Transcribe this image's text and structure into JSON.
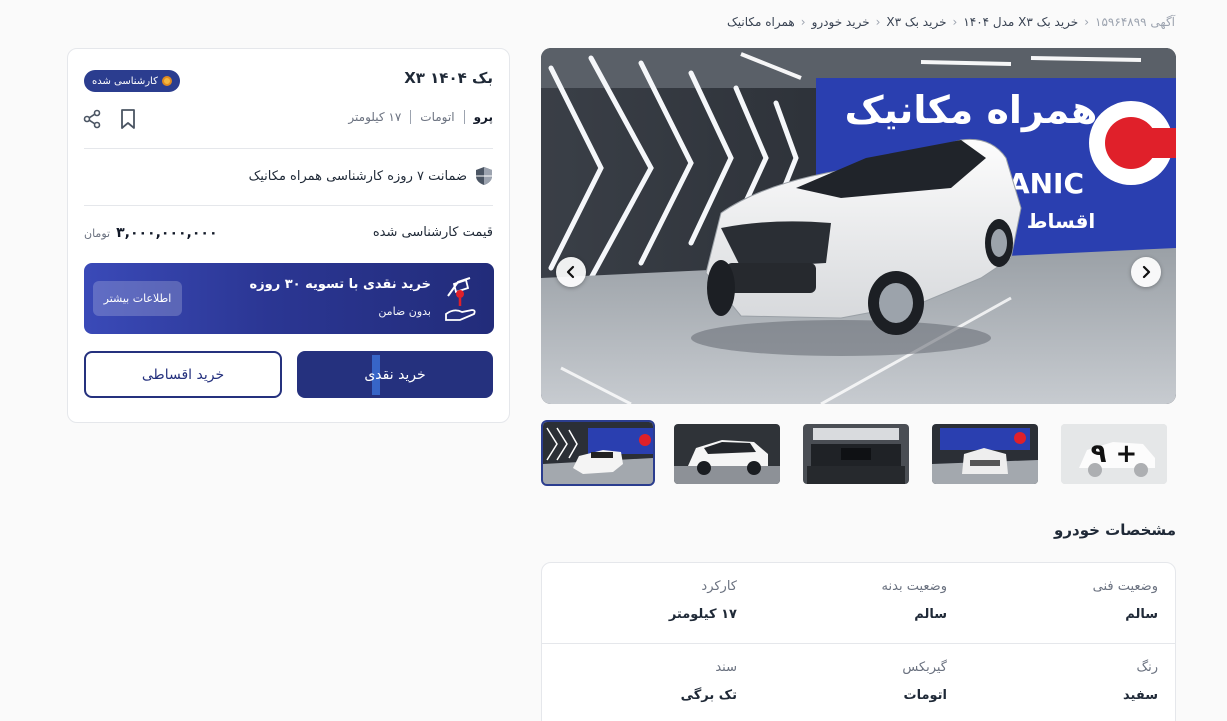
{
  "breadcrumb": {
    "items": [
      "همراه مکانیک",
      "خرید خودرو",
      "خرید بک X۳",
      "خرید بک X۳ مدل ۱۴۰۴"
    ],
    "ad_label": "آگهی ۱۵۹۶۴۸۹۹"
  },
  "gallery": {
    "banner_text": "همراه مکانیک",
    "banner_sub": "ANIC",
    "banner_sub2": "اقساط",
    "more_count": "۹ +"
  },
  "card": {
    "title": "بک X۳ ۱۴۰۴",
    "badge": "کارشناسی شده",
    "specs": [
      "پرو",
      "اتومات",
      "۱۷ کیلومتر"
    ],
    "warranty": "ضمانت ۷ روزه کارشناسی همراه مکانیک",
    "price_label": "قیمت کارشناسی شده",
    "price_value": "۳,۰۰۰,۰۰۰,۰۰۰",
    "price_currency": "تومان",
    "promo": {
      "title": "خرید نقدی با تسویه ۳۰ روزه",
      "subtitle": "بدون ضامن",
      "more": "اطلاعات بیشتر"
    },
    "buy_cash": "خرید نقدی",
    "buy_installment": "خرید اقساطی"
  },
  "specifications": {
    "heading": "مشخصات خودرو",
    "rows": [
      [
        {
          "label": "وضعیت فنی",
          "value": "سالم"
        },
        {
          "label": "وضعیت بدنه",
          "value": "سالم"
        },
        {
          "label": "کارکرد",
          "value": "۱۷ کیلومتر"
        }
      ],
      [
        {
          "label": "رنگ",
          "value": "سفید"
        },
        {
          "label": "گیربکس",
          "value": "اتومات"
        },
        {
          "label": "سند",
          "value": "تک برگی"
        }
      ]
    ]
  },
  "colors": {
    "primary": "#25317e",
    "accent_red": "#e0202a",
    "banner_blue": "#2a3fb0"
  }
}
